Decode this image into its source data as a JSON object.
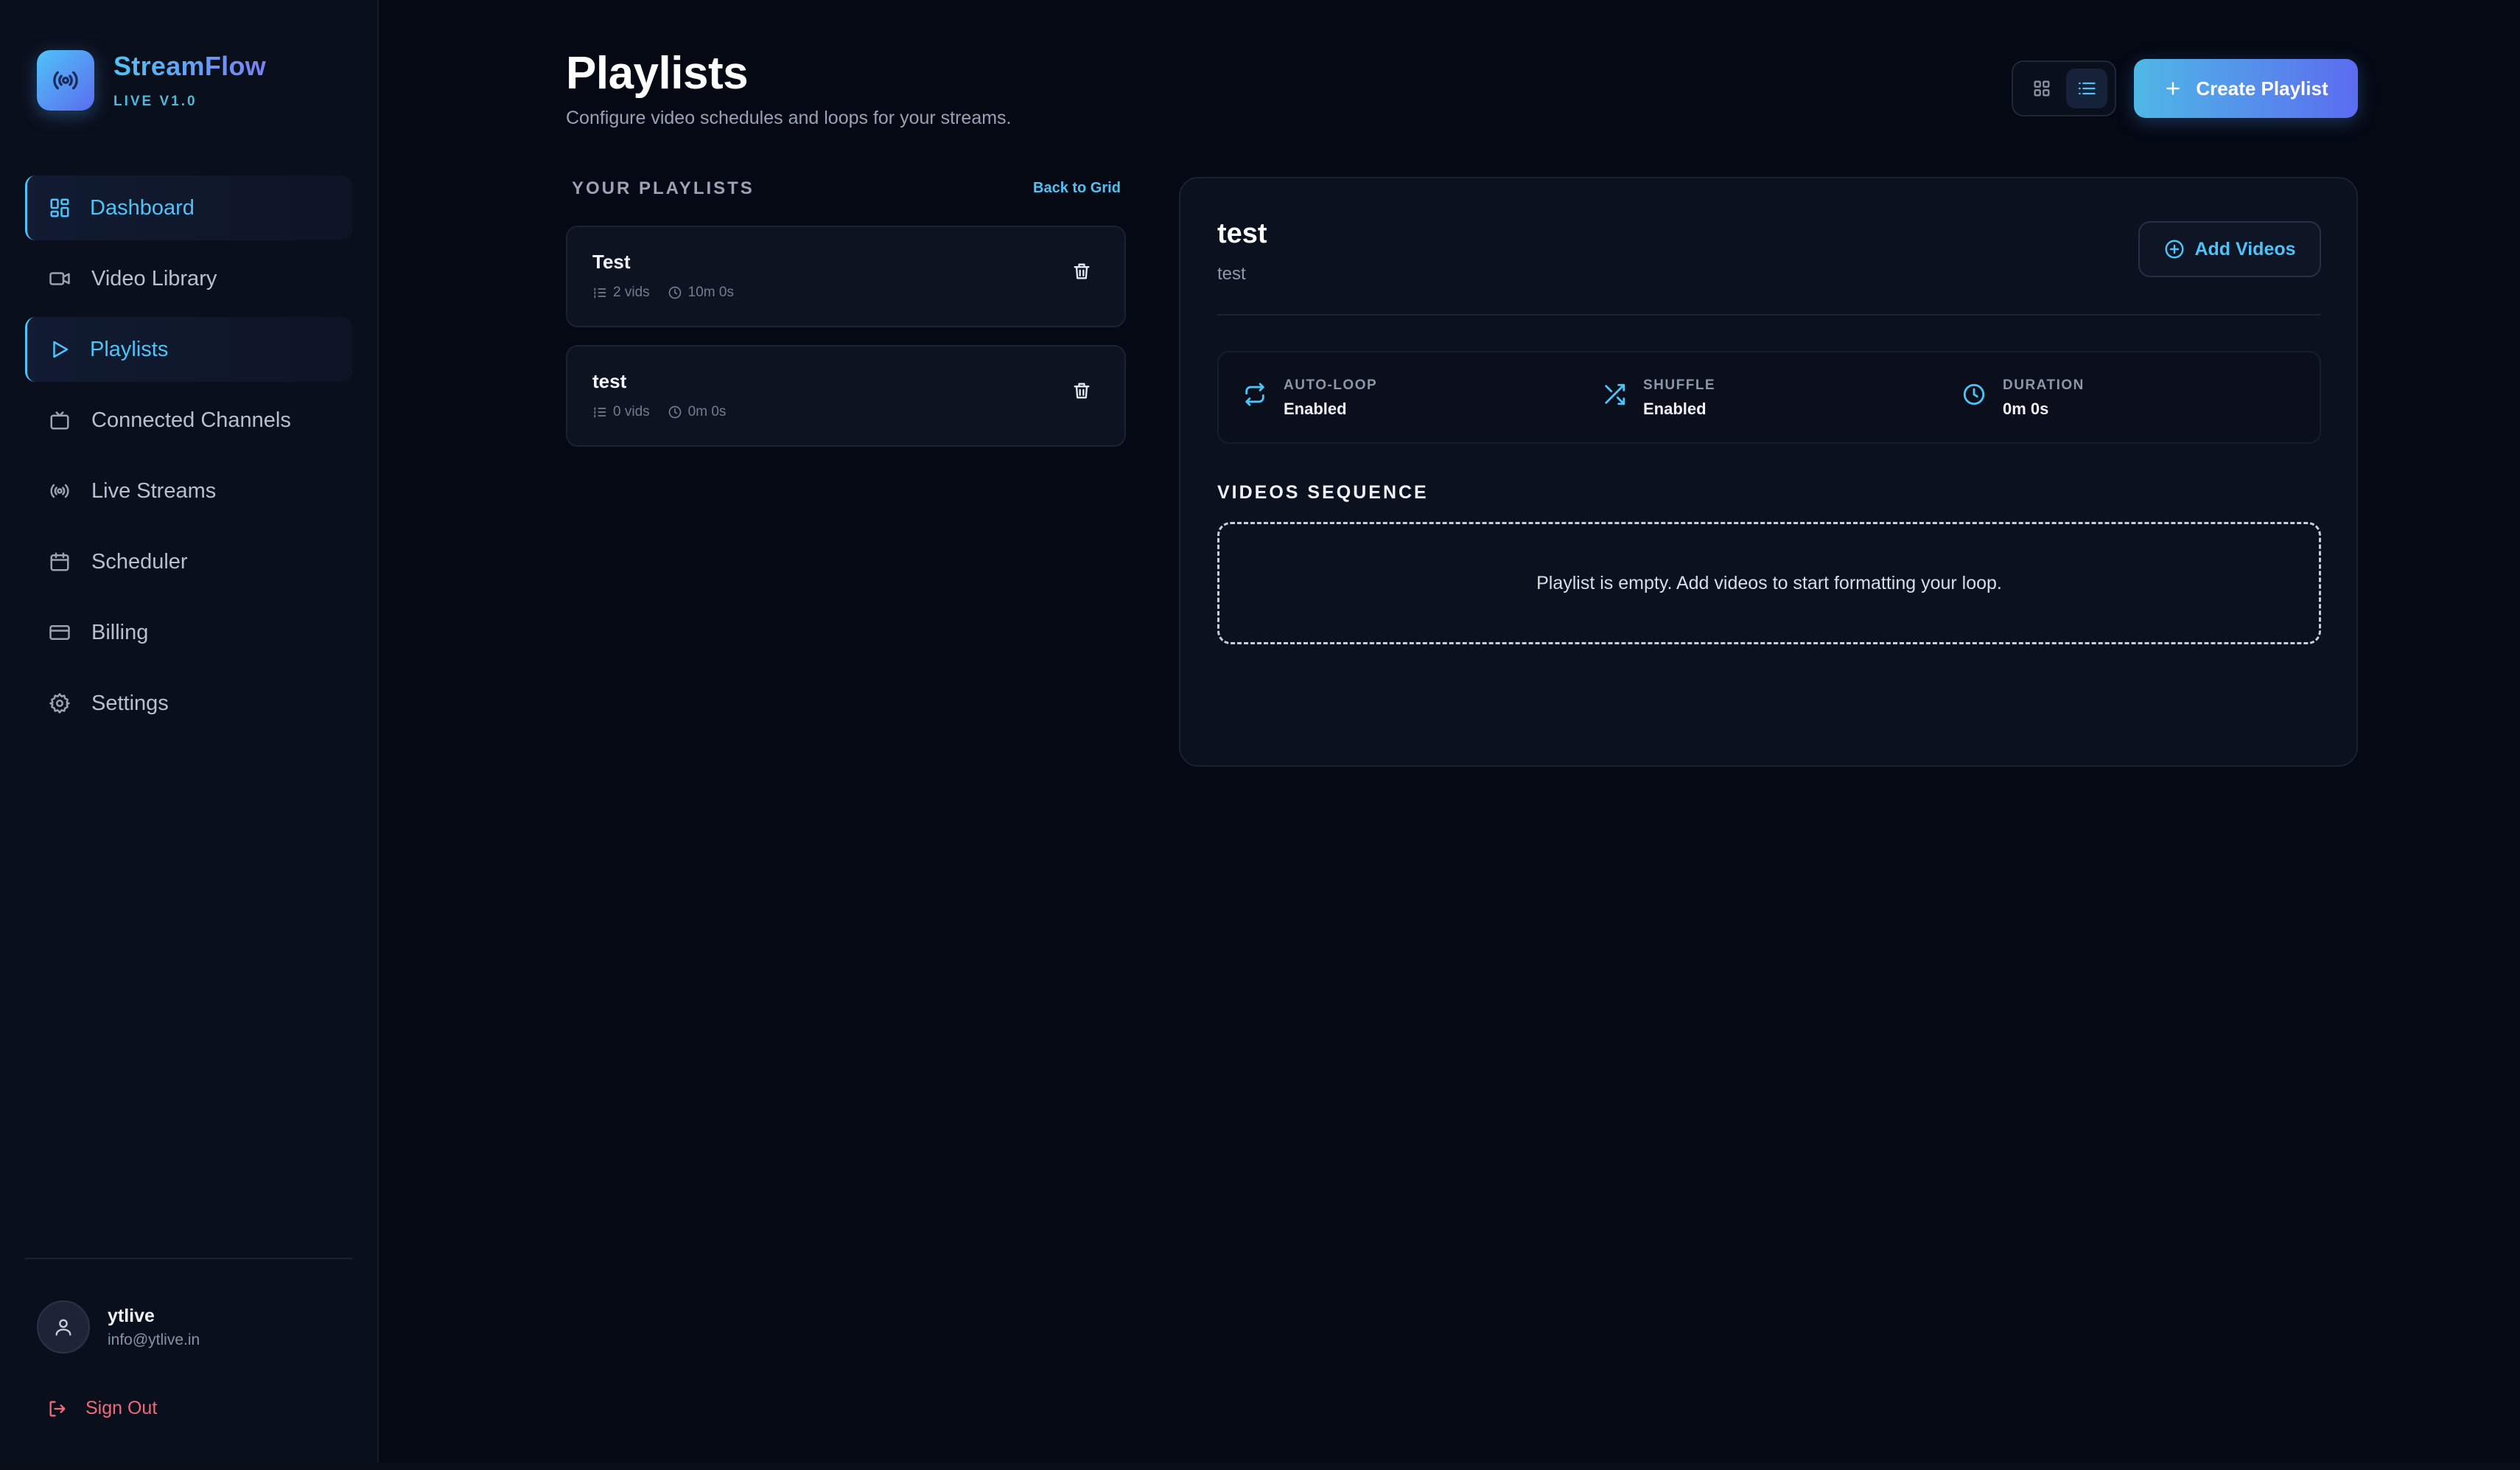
{
  "brand": {
    "name": "StreamFlow",
    "version": "LIVE V1.0"
  },
  "nav": [
    {
      "label": "Dashboard",
      "icon": "dashboard-icon",
      "active": true
    },
    {
      "label": "Video Library",
      "icon": "video-icon",
      "active": false
    },
    {
      "label": "Playlists",
      "icon": "play-icon",
      "active": true
    },
    {
      "label": "Connected Channels",
      "icon": "tv-icon",
      "active": false
    },
    {
      "label": "Live Streams",
      "icon": "broadcast-icon",
      "active": false
    },
    {
      "label": "Scheduler",
      "icon": "calendar-icon",
      "active": false
    },
    {
      "label": "Billing",
      "icon": "credit-card-icon",
      "active": false
    },
    {
      "label": "Settings",
      "icon": "gear-icon",
      "active": false
    }
  ],
  "user": {
    "name": "ytlive",
    "email": "info@ytlive.in",
    "signout_label": "Sign Out"
  },
  "header": {
    "title": "Playlists",
    "subtitle": "Configure video schedules and loops for your streams.",
    "create_label": "Create Playlist",
    "active_view": "list"
  },
  "list": {
    "heading": "YOUR PLAYLISTS",
    "back_label": "Back to Grid",
    "items": [
      {
        "title": "Test",
        "vids": "2 vids",
        "duration": "10m 0s"
      },
      {
        "title": "test",
        "vids": "0 vids",
        "duration": "0m 0s"
      }
    ]
  },
  "detail": {
    "title": "test",
    "description": "test",
    "add_label": "Add Videos",
    "stats": [
      {
        "label": "AUTO-LOOP",
        "value": "Enabled",
        "icon": "repeat-icon"
      },
      {
        "label": "SHUFFLE",
        "value": "Enabled",
        "icon": "shuffle-icon"
      },
      {
        "label": "DURATION",
        "value": "0m 0s",
        "icon": "clock-icon"
      }
    ],
    "sequence_heading": "VIDEOS SEQUENCE",
    "empty_message": "Playlist is empty. Add videos to start formatting your loop."
  },
  "colors": {
    "accent": "#4fc3f7",
    "accent2": "#5b6cf0",
    "danger": "#f06a7a",
    "background": "#050914"
  }
}
